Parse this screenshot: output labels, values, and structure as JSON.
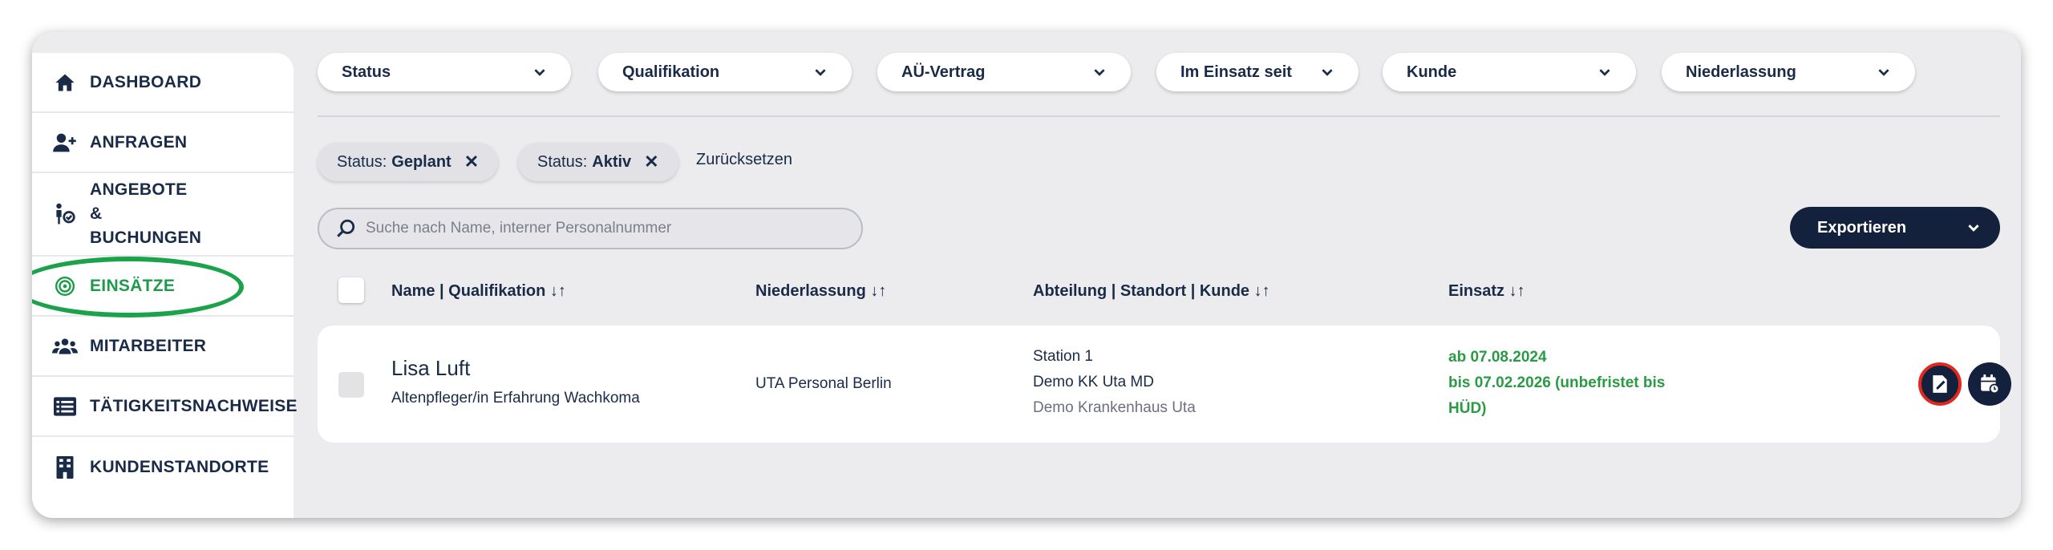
{
  "sidebar": {
    "items": [
      {
        "label": "DASHBOARD",
        "icon": "home-icon"
      },
      {
        "label": "ANFRAGEN",
        "icon": "add-person-icon"
      },
      {
        "label": "ANGEBOTE & BUCHUNGEN",
        "icon": "offers-icon"
      },
      {
        "label": "EINSÄTZE",
        "icon": "target-icon",
        "active": true
      },
      {
        "label": "MITARBEITER",
        "icon": "group-icon"
      },
      {
        "label": "TÄTIGKEITSNACHWEISE",
        "icon": "list-icon"
      },
      {
        "label": "KUNDENSTANDORTE",
        "icon": "building-icon"
      }
    ]
  },
  "filters": [
    "Status",
    "Qualifikation",
    "AÜ-Vertrag",
    "Im Einsatz seit",
    "Kunde",
    "Niederlassung"
  ],
  "chips": [
    {
      "prefix": "Status:",
      "value": "Geplant"
    },
    {
      "prefix": "Status:",
      "value": "Aktiv"
    }
  ],
  "reset_label": "Zurücksetzen",
  "search": {
    "placeholder": "Suche nach Name, interner Personalnummer"
  },
  "export_label": "Exportieren",
  "table": {
    "headers": [
      "Name | Qualifikation ↓↑",
      "Niederlassung ↓↑",
      "Abteilung | Standort | Kunde ↓↑",
      "Einsatz ↓↑"
    ],
    "rows": [
      {
        "name": "Lisa Luft",
        "qualification": "Altenpfleger/in Erfahrung Wachkoma",
        "branch": "UTA Personal Berlin",
        "department": "Station 1",
        "location": "Demo KK Uta MD",
        "customer": "Demo Krankenhaus Uta",
        "start": "ab 07.08.2024",
        "end_line1": "bis 07.02.2026 (unbefristet bis",
        "end_line2": "HÜD)"
      }
    ]
  },
  "colors": {
    "accent_green": "#1e9b4a",
    "navy": "#14213d",
    "highlight_red": "#e0281f"
  }
}
